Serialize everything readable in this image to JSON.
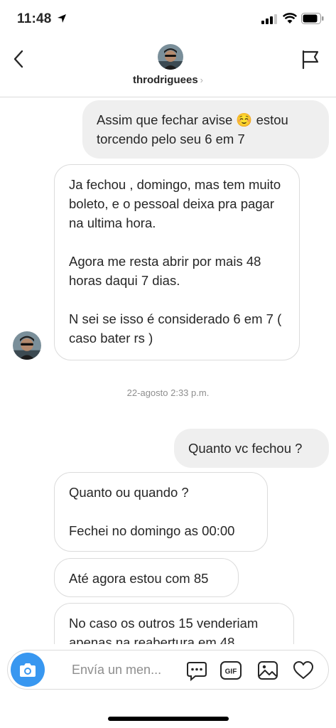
{
  "status_bar": {
    "time": "11:48"
  },
  "header": {
    "username": "throdriguees",
    "username_chevron": "›"
  },
  "messages": [
    {
      "paragraphs": [
        "Assim que fechar avise ☺️ estou torcendo pelo seu 6 em 7"
      ]
    },
    {
      "paragraphs": [
        "Ja fechou , domingo, mas tem muito boleto, e o pessoal deixa pra pagar na ultima hora.",
        "Agora me resta abrir por mais 48 horas daqui 7 dias.",
        "N sei se isso é considerado 6 em 7 ( caso bater rs )"
      ]
    },
    {
      "paragraphs": [
        "Quanto vc fechou ?"
      ]
    },
    {
      "paragraphs": [
        "Quanto ou quando ?",
        "Fechei no domingo as 00:00"
      ]
    },
    {
      "paragraphs": [
        "Até agora estou com 85"
      ]
    },
    {
      "paragraphs": [
        "No caso os outros 15 venderiam apenas na reabertura em 48"
      ]
    }
  ],
  "timestamp": "22-agosto 2:33 p.m.",
  "composer": {
    "placeholder": "Envía un men..."
  },
  "icons": {
    "back": "chevron-left-icon",
    "flag": "flag-icon",
    "camera": "camera-icon",
    "chat": "chat-bubble-icon",
    "gif": "gif-icon",
    "gallery": "image-icon",
    "like": "heart-icon",
    "gif_label": "GIF"
  },
  "colors": {
    "accent": "#3897f0",
    "outgoing_bubble": "#efefef",
    "incoming_border": "#dbdbdb",
    "secondary_text": "#8e8e8e"
  }
}
